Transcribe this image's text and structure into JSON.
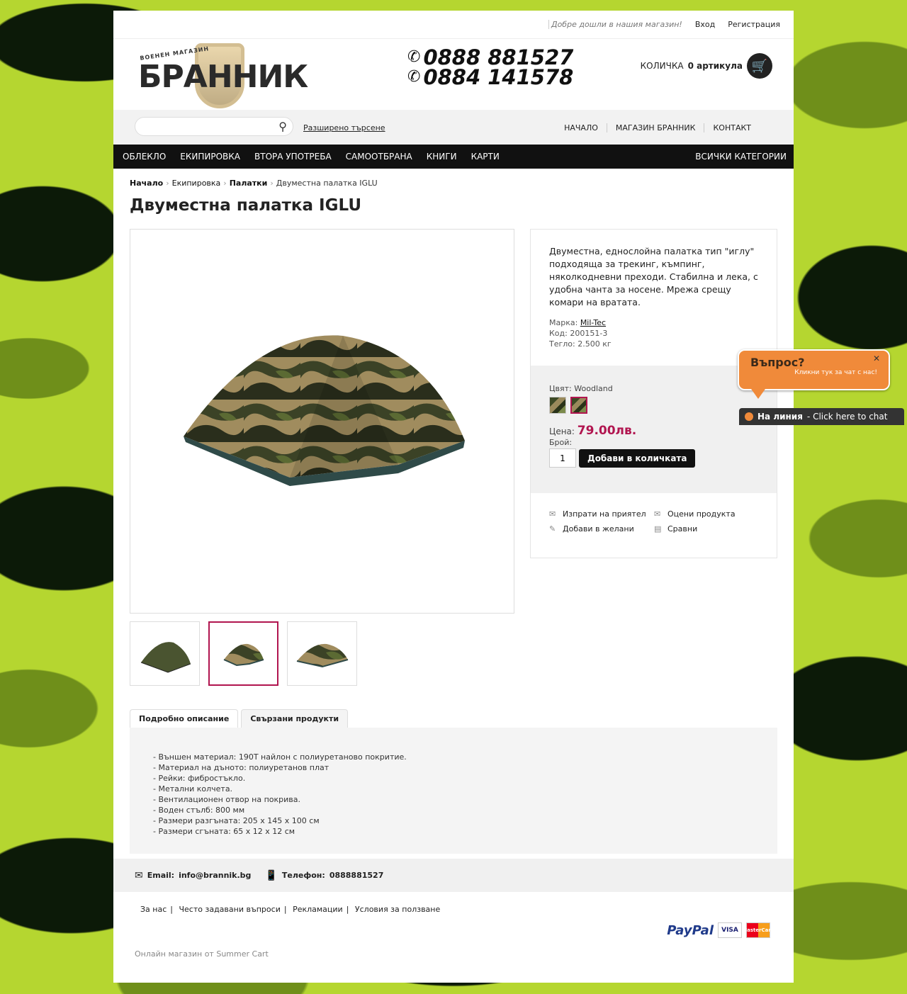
{
  "topbar": {
    "welcome": "Добре дошли в нашия магазин!",
    "login": "Вход",
    "register": "Регистрация"
  },
  "logo": {
    "small": "ВОЕНЕН МАГАЗИН",
    "big": "БРАННИК"
  },
  "phones": [
    "0888 881527",
    "0884 141578"
  ],
  "cart": {
    "label": "КОЛИЧКА",
    "count": "0 артикула",
    "icon": "cart-icon"
  },
  "search": {
    "placeholder": "",
    "advanced": "Разширено търсене"
  },
  "top_links": [
    "НАЧАЛО",
    "МАГАЗИН БРАННИК",
    "КОНТАКТ"
  ],
  "nav": {
    "items": [
      "ОБЛЕКЛО",
      "ЕКИПИРОВКА",
      "ВТОРА УПОТРЕБА",
      "САМООТБРАНА",
      "КНИГИ",
      "КАРТИ"
    ],
    "all": "ВСИЧКИ КАТЕГОРИИ"
  },
  "breadcrumb": [
    "Начало",
    "Екипировка",
    "Палатки",
    "Двуместна палатка IGLU"
  ],
  "product": {
    "title": "Двуместна палатка IGLU",
    "description": "Двуместна, еднослойна палатка тип \"иглу\" подходяща за трекинг, къмпинг, няколкодневни преходи. Стабилна и лека, с удобна чанта за носене. Мрежа срещу комари на вратата.",
    "brand_label": "Марка:",
    "brand": "Mil-Tec",
    "code_label": "Код:",
    "code": "200151-3",
    "weight_label": "Тегло:",
    "weight": "2.500 кг",
    "color_label": "Цвят:",
    "color": "Woodland",
    "price_label": "Цена:",
    "price": "79.00лв.",
    "qty_label": "Брой:",
    "qty": "1",
    "add_to_cart": "Добави в количката"
  },
  "actions": [
    "Изпрати на приятел",
    "Оцени продукта",
    "Добави в желани",
    "Сравни"
  ],
  "tabs": [
    "Подробно описание",
    "Свързани продукти"
  ],
  "details": [
    "- Външен материал: 190T найлон с полиуретаново покритие.",
    "- Материал на дъното: полиуретанов плат",
    "- Рейки: фибростъкло.",
    "- Метални колчета.",
    "- Вентилационен отвор на покрива.",
    "- Воден стълб: 800 мм",
    "- Размери разгъната: 205 х 145 х 100 см",
    "- Размери сгъната: 65 х 12 х 12 см"
  ],
  "footer": {
    "email_label": "Email:",
    "email": "info@brannik.bg",
    "phone_label": "Телефон:",
    "phone": "0888881527",
    "links": [
      "За нас",
      "Често задавани въпроси",
      "Рекламации",
      "Условия за ползване"
    ],
    "payments": [
      "PayPal",
      "VISA",
      "MasterCard"
    ],
    "powered": "Онлайн магазин от Summer Cart"
  },
  "chat": {
    "question": "Въпрос?",
    "sub": "Кликни тук за чат с нас!",
    "status": "На линия",
    "cta": "- Click here to chat"
  },
  "colors": {
    "accent": "#b1154f",
    "nav_bg": "#111111",
    "chat": "#f08a3a"
  }
}
